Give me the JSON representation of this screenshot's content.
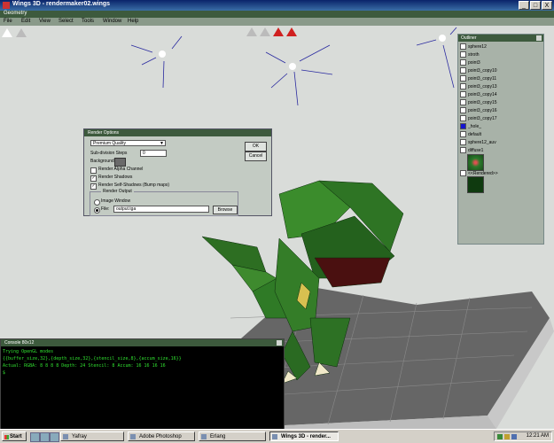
{
  "window": {
    "title": "Wings 3D - rendermaker02.wings",
    "minimize": "_",
    "maximize": "□",
    "close": "X"
  },
  "geometry_bar": {
    "label": "Geometry"
  },
  "menu": [
    "File",
    "Edit",
    "View",
    "Select",
    "Tools",
    "Window",
    "Help"
  ],
  "toolbar_icons": [
    "vertex-mode-icon",
    "edge-mode-icon",
    "face-mode-icon",
    "body-mode-icon",
    "object-mode-icon",
    "view-icon"
  ],
  "outliner": {
    "title": "Outliner",
    "items": [
      "sphere12",
      "stroth",
      "point3",
      "point3_copy10",
      "point3_copy11",
      "point3_copy13",
      "point3_copy14",
      "point3_copy15",
      "point3_copy16",
      "point3_copy17",
      "_hole_",
      "default",
      "sphere12_auv",
      "diffuse1",
      "<<Rendered>>"
    ]
  },
  "render_dialog": {
    "title": "Render Options",
    "quality": "Premium Quality",
    "subdivision_label": "Sub-division Steps",
    "subdivision_value": "0",
    "bg_color_label": "Background Color",
    "bg_color": "#6a6a6a",
    "alpha_label": "Render Alpha Channel",
    "shadows_label": "Render Shadows",
    "self_shadows_label": "Render Self-Shadows (Bump maps)",
    "output_group": "Render Output",
    "image_window_label": "Image Window",
    "file_label": "File:",
    "file_value": "output.tga",
    "browse": "Browse",
    "ok": "OK",
    "cancel": "Cancel"
  },
  "console": {
    "title": "Console 80x12",
    "lines": [
      "Trying OpenGL modes",
      "  {{buffer_size,32},{depth_size,32},{stencil_size,8},{accum_size,16}}",
      "Actual: RGBA: 8 8 8 8 Depth: 24 Stencil: 8 Accum: 16 16 16 16",
      "$"
    ]
  },
  "taskbar": {
    "start": "Start",
    "tasks": [
      "Yafray",
      "Adobe Photoshop",
      "Erlang",
      "Wings 3D - render..."
    ],
    "clock": "12:21 AM"
  }
}
